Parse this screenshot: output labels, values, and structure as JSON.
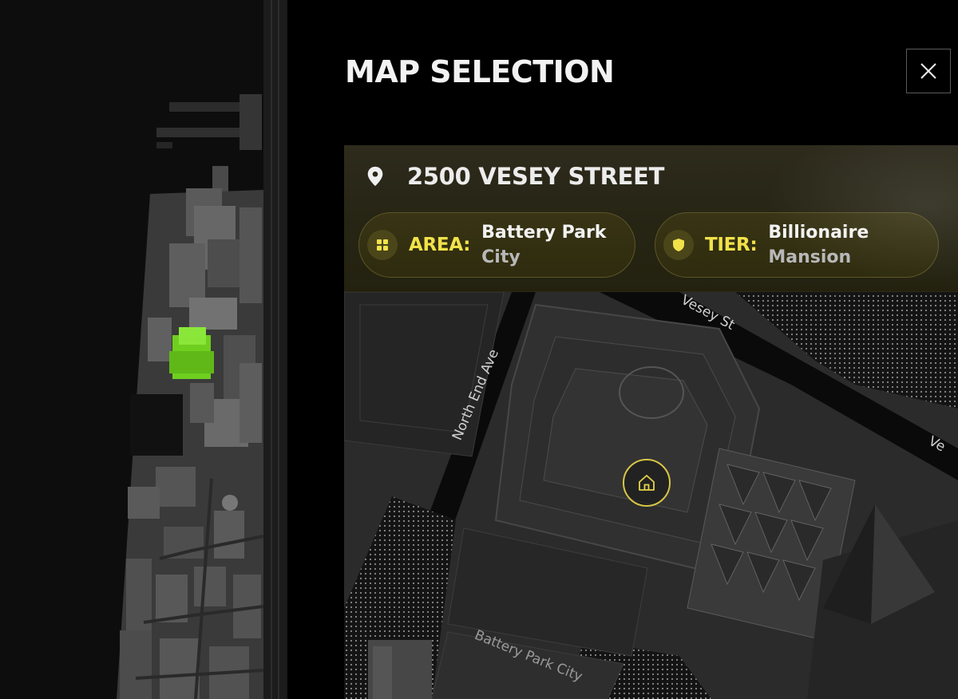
{
  "header": {
    "title": "MAP SELECTION",
    "close_icon": "close-icon"
  },
  "property": {
    "address": "2500 VESEY STREET",
    "address_icon": "location-pin-icon",
    "area": {
      "label": "AREA:",
      "value_line1": "Battery Park",
      "value_line2": "City",
      "icon": "grid-icon"
    },
    "tier": {
      "label": "TIER:",
      "value_line1": "Billionaire",
      "value_line2": "Mansion",
      "icon": "shield-icon"
    }
  },
  "map": {
    "marker_icon": "home-icon",
    "street_labels": {
      "north_end_ave": "North End Ave",
      "vesey_st": "Vesey St",
      "vesey_partial": "Ve",
      "battery_park_city": "Battery Park City"
    }
  },
  "colors": {
    "accent": "#f1e24a",
    "selected_building": "#7ed321",
    "panel_background": "#000000"
  }
}
